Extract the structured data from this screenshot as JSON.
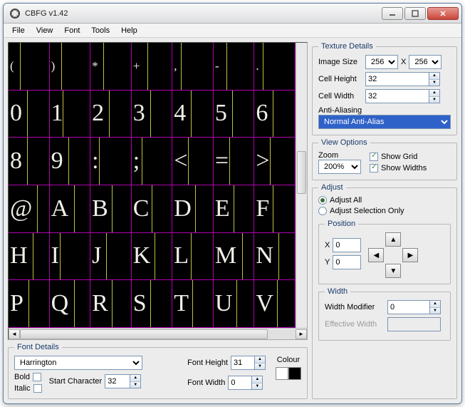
{
  "window": {
    "title": "CBFG v1.42"
  },
  "menu": {
    "file": "File",
    "view": "View",
    "font": "Font",
    "tools": "Tools",
    "help": "Help"
  },
  "glyphs": {
    "row0": [
      "(",
      ")",
      "*",
      "+",
      ",",
      "-",
      "."
    ],
    "rows": [
      [
        "0",
        "1",
        "2",
        "3",
        "4",
        "5",
        "6"
      ],
      [
        "8",
        "9",
        ":",
        ";",
        "<",
        "=",
        ">"
      ],
      [
        "@",
        "A",
        "B",
        "C",
        "D",
        "E",
        "F"
      ],
      [
        "H",
        "I",
        "J",
        "K",
        "L",
        "M",
        "N"
      ],
      [
        "P",
        "Q",
        "R",
        "S",
        "T",
        "U",
        "V"
      ]
    ]
  },
  "fontDetails": {
    "legend": "Font Details",
    "fontName": "Harrington",
    "boldLabel": "Bold",
    "bold": false,
    "italicLabel": "Italic",
    "italic": false,
    "startCharLabel": "Start Character",
    "startChar": "32",
    "fontHeightLabel": "Font Height",
    "fontHeight": "31",
    "fontWidthLabel": "Font Width",
    "fontWidth": "0",
    "colourLabel": "Colour",
    "colours": {
      "fg": "#ffffff",
      "bg": "#000000"
    }
  },
  "texture": {
    "legend": "Texture Details",
    "imageSizeLabel": "Image Size",
    "imgW": "256",
    "imgH": "256",
    "x": "X",
    "cellHeightLabel": "Cell Height",
    "cellHeight": "32",
    "cellWidthLabel": "Cell Width",
    "cellWidth": "32",
    "aaLabel": "Anti-Aliasing",
    "aaValue": "Normal Anti-Alias"
  },
  "viewOptions": {
    "legend": "View Options",
    "zoomLabel": "Zoom",
    "zoom": "200%",
    "showGridLabel": "Show Grid",
    "showGrid": true,
    "showWidthsLabel": "Show Widths",
    "showWidths": true
  },
  "adjust": {
    "legend": "Adjust",
    "allLabel": "Adjust All",
    "selLabel": "Adjust Selection Only",
    "positionLegend": "Position",
    "xLabel": "X",
    "x": "0",
    "yLabel": "Y",
    "y": "0",
    "widthLegend": "Width",
    "widthModLabel": "Width Modifier",
    "widthMod": "0",
    "effWidthLabel": "Effective Width",
    "effWidth": ""
  }
}
